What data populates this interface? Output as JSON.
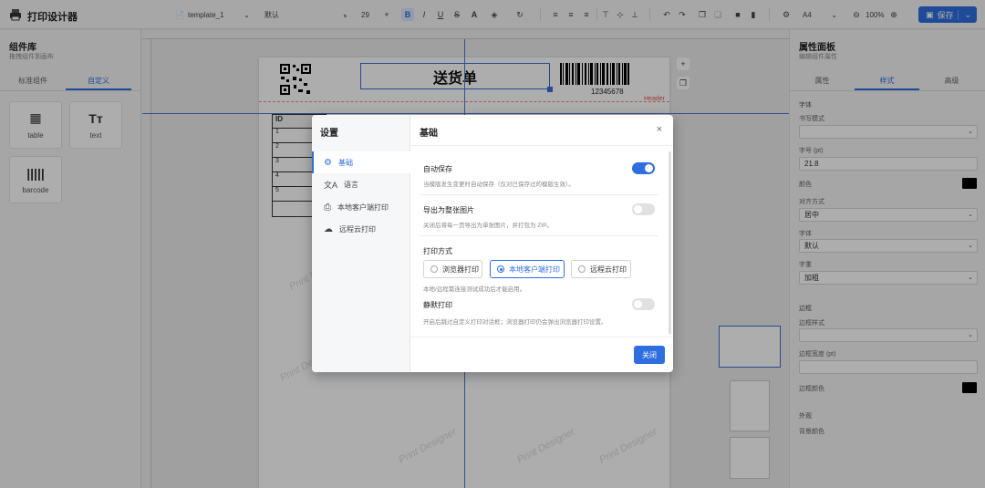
{
  "app": {
    "title": "打印设计器"
  },
  "toolbar": {
    "template_name": "template_1",
    "font_family": "默认",
    "font_size": "29",
    "paper_size": "A4",
    "zoom": "100%",
    "save_label": "保存"
  },
  "left_panel": {
    "title": "组件库",
    "subtitle": "拖拽组件到画布",
    "tabs": [
      "标准组件",
      "自定义"
    ],
    "active_tab": "自定义",
    "components": [
      {
        "label": "table",
        "icon": "table-icon"
      },
      {
        "label": "text",
        "icon": "text-icon"
      },
      {
        "label": "barcode",
        "icon": "barcode-icon"
      }
    ]
  },
  "canvas": {
    "title_text": "送货单",
    "barcode_number": "12345678",
    "header_tag": "Header",
    "table_header": "ID",
    "table_rows": [
      "1",
      "2",
      "3",
      "4",
      "5"
    ],
    "watermark": "Print Designer"
  },
  "right_panel": {
    "title": "属性面板",
    "subtitle": "编辑组件属性",
    "tabs": [
      "属性",
      "样式",
      "高级"
    ],
    "active_tab": "样式",
    "font_section": "字体",
    "labels": {
      "font_style": "书写模式",
      "font_size": "字号 (pt)",
      "color": "颜色",
      "align": "对齐方式",
      "font": "字体",
      "weight": "字重",
      "border_section": "边框",
      "border_style": "边框样式",
      "border_width": "边框宽度 (pt)",
      "border_color": "边框颜色",
      "appearance_section": "外观",
      "bg_color": "背景颜色"
    },
    "values": {
      "font_size": "21.8",
      "align": "居中",
      "font": "默认",
      "weight": "加粗"
    },
    "colors": {
      "text_color": "#000000",
      "border_color": "#000000"
    }
  },
  "modal": {
    "sidebar_title": "设置",
    "nav": [
      {
        "label": "基础",
        "icon": "gear-icon",
        "active": true
      },
      {
        "label": "语言",
        "icon": "translate-icon",
        "active": false
      },
      {
        "label": "本地客户端打印",
        "icon": "printer-icon",
        "active": false
      },
      {
        "label": "远程云打印",
        "icon": "cloud-icon",
        "active": false
      }
    ],
    "header": "基础",
    "autosave": {
      "label": "自动保存",
      "desc": "当模版发生变更时自动保存（仅对已保存过的模版生效）。",
      "on": true
    },
    "export_image": {
      "label": "导出为整张图片",
      "desc": "关闭后将每一页导出为单张图片，并打包为 ZIP。",
      "on": false
    },
    "print_mode": {
      "label": "打印方式",
      "options": [
        "浏览器打印",
        "本地客户端打印",
        "远程云打印"
      ],
      "selected": "本地客户端打印",
      "hint": "本地/远程需连接测试成功后才能启用。"
    },
    "silent_print": {
      "label": "静默打印",
      "desc": "开启后跳过自定义打印对话框；浏览器打印仍会弹出浏览器打印设置。",
      "on": false
    },
    "close_label": "关闭",
    "accent": "#2f6ee0"
  }
}
